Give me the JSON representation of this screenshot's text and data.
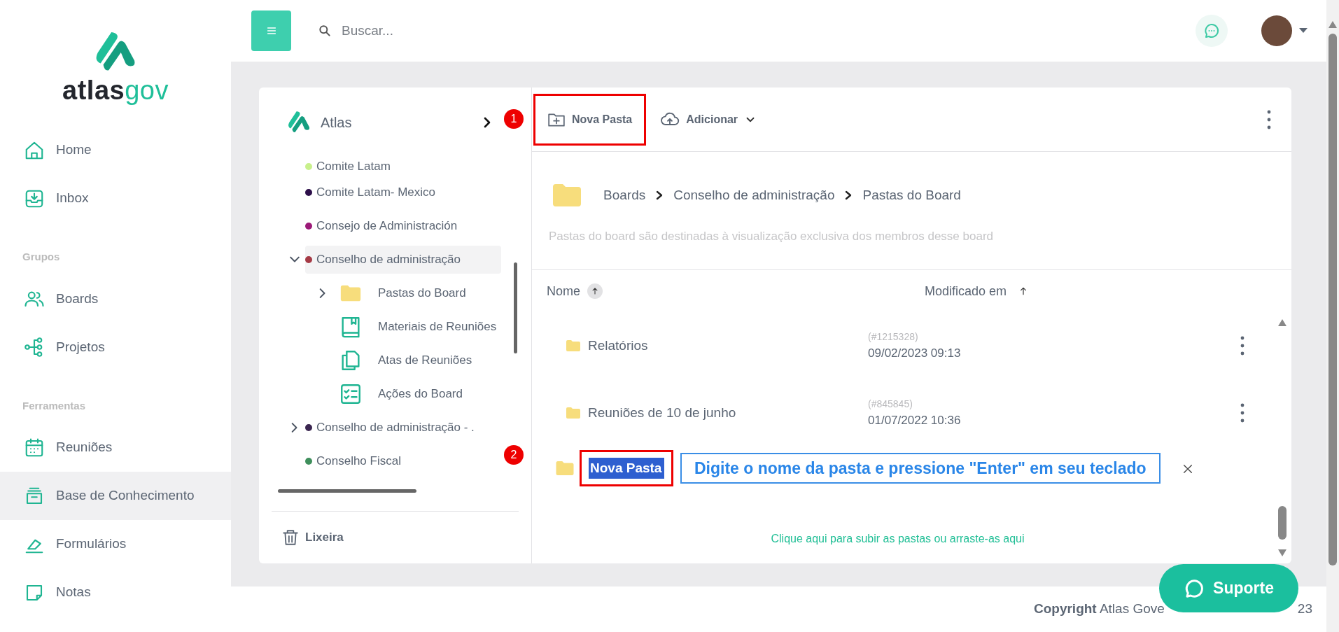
{
  "logo": {
    "dark": "atlas",
    "light": "gov"
  },
  "sidebar": {
    "sections": [
      {
        "items": [
          {
            "label": "Home",
            "kind": "home",
            "selected": false
          },
          {
            "label": "Inbox",
            "kind": "inbox",
            "selected": false
          }
        ]
      },
      {
        "heading": "Grupos",
        "items": [
          {
            "label": "Boards",
            "kind": "users",
            "selected": false
          },
          {
            "label": "Projetos",
            "kind": "nodes",
            "selected": false
          }
        ]
      },
      {
        "heading": "Ferramentas",
        "items": [
          {
            "label": "Reuniões",
            "kind": "calendar",
            "selected": false
          },
          {
            "label": "Base de Conhecimento",
            "kind": "archive",
            "selected": true
          },
          {
            "label": "Formulários",
            "kind": "pen",
            "selected": false
          },
          {
            "label": "Notas",
            "kind": "note",
            "selected": false
          }
        ]
      }
    ]
  },
  "header": {
    "search": {
      "placeholder": "Buscar..."
    }
  },
  "tree": {
    "title": "Atlas",
    "items": [
      {
        "label": "Comite Latam",
        "color": "#c8f08c",
        "selected": false
      },
      {
        "label": "Comite Latam- Mexico",
        "color": "#2d0f4a",
        "selected": false
      },
      {
        "label": "Consejo de Administración",
        "color": "#9c1a78",
        "selected": false
      },
      {
        "label": "Conselho de administração",
        "color": "#a53a45",
        "expanded": true,
        "selected": true,
        "children": [
          {
            "label": "Pastas do Board",
            "kind": "folder",
            "expanded": false
          },
          {
            "label": "Materiais de Reuniões",
            "kind": "book"
          },
          {
            "label": "Atas de Reuniões",
            "kind": "docs"
          },
          {
            "label": "Ações do Board",
            "kind": "checklist"
          }
        ]
      },
      {
        "label": "Conselho de administração - .",
        "color": "#3b2650",
        "expanded": false,
        "selected": false
      },
      {
        "label": "Conselho Fiscal",
        "color": "#3f8f5c",
        "selected": false
      }
    ],
    "trash": "Lixeira"
  },
  "toolbar": {
    "new_folder": {
      "label": "Nova Pasta",
      "highlighted": true
    },
    "add": {
      "label": "Adicionar"
    }
  },
  "breadcrumb": [
    "Boards",
    "Conselho de administração",
    "Pastas do Board"
  ],
  "description": "Pastas do board são destinadas à visualização exclusiva dos membros desse board",
  "table": {
    "columns": [
      {
        "label": "Nome",
        "sort_badge": true
      },
      {
        "label": "Modificado em",
        "sort_badge": false
      }
    ],
    "rows": [
      {
        "name": "Relatórios",
        "id": "(#1215328)",
        "modified": "09/02/2023 09:13"
      },
      {
        "name": "Reuniões de 10 de junho",
        "id": "(#845845)",
        "modified": "01/07/2022 10:36"
      }
    ]
  },
  "new_folder_row": {
    "value": "Nova Pasta",
    "highlighted": true,
    "hint": "Digite o nome da pasta e pressione \"Enter\" em seu teclado"
  },
  "upload_hint": "Clique aqui para subir as pastas ou arraste-as aqui",
  "annotations": [
    {
      "number": "1"
    },
    {
      "number": "2"
    }
  ],
  "footer": {
    "copyright": "**Copyright** Atlas Gove",
    "tail": "23"
  },
  "support": {
    "label": "Suporte"
  }
}
